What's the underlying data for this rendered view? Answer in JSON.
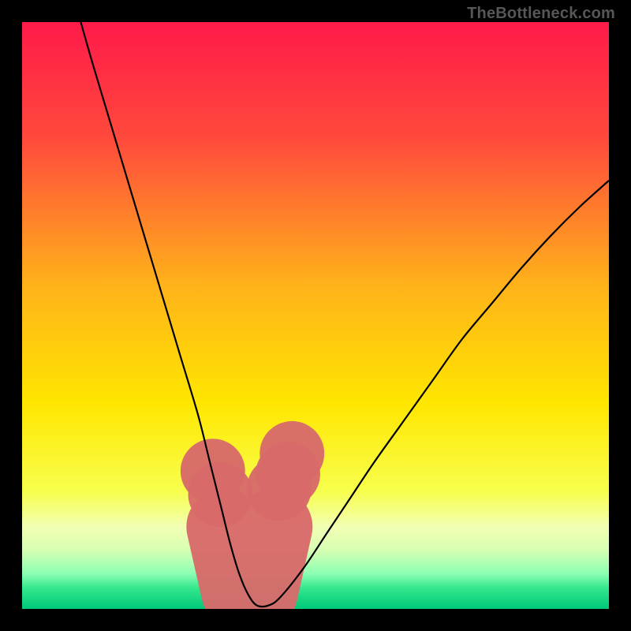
{
  "watermark": "TheBottleneck.com",
  "chart_data": {
    "type": "line",
    "title": "",
    "xlabel": "",
    "ylabel": "",
    "xlim": [
      0,
      100
    ],
    "ylim": [
      0,
      100
    ],
    "grid": false,
    "legend": false,
    "background_gradient": [
      {
        "pos": 0.0,
        "color": "#ff1a4a"
      },
      {
        "pos": 0.2,
        "color": "#ff4a3c"
      },
      {
        "pos": 0.45,
        "color": "#ffb31a"
      },
      {
        "pos": 0.65,
        "color": "#ffe600"
      },
      {
        "pos": 0.8,
        "color": "#f7ff4d"
      },
      {
        "pos": 0.86,
        "color": "#f2ffb3"
      },
      {
        "pos": 0.9,
        "color": "#d6ffb3"
      },
      {
        "pos": 0.94,
        "color": "#8cffb3"
      },
      {
        "pos": 0.965,
        "color": "#33e68c"
      },
      {
        "pos": 1.0,
        "color": "#00c97a"
      }
    ],
    "series": [
      {
        "name": "bottleneck-curve",
        "color": "#000000",
        "width": 2.2,
        "x": [
          10,
          12,
          15,
          18,
          21,
          24,
          27,
          30,
          32,
          34,
          35.5,
          37,
          38.5,
          40,
          42,
          44,
          48,
          52,
          56,
          60,
          65,
          70,
          75,
          80,
          85,
          90,
          95,
          100
        ],
        "y": [
          100,
          93,
          83,
          73,
          63,
          53,
          43,
          33,
          25,
          17,
          11,
          6,
          2.5,
          0.6,
          0.6,
          2,
          7,
          13,
          19,
          25,
          32,
          39,
          46,
          52,
          58,
          63.5,
          68.5,
          73
        ]
      }
    ],
    "trough_band": {
      "color": "#d76a6a",
      "radius": 5.5,
      "dots_x": [
        32.5,
        33.8,
        43.8,
        45.3,
        46.0
      ],
      "dots_y": [
        23.5,
        19.5,
        20.5,
        23.0,
        26.5
      ],
      "sausage": {
        "x0": 34.5,
        "y0": 14.0,
        "x1": 37.0,
        "y1": 3.0,
        "x2": 40.5,
        "y2": 2.8,
        "x3": 43.0,
        "y3": 14.0,
        "half_width": 6.5
      }
    }
  }
}
